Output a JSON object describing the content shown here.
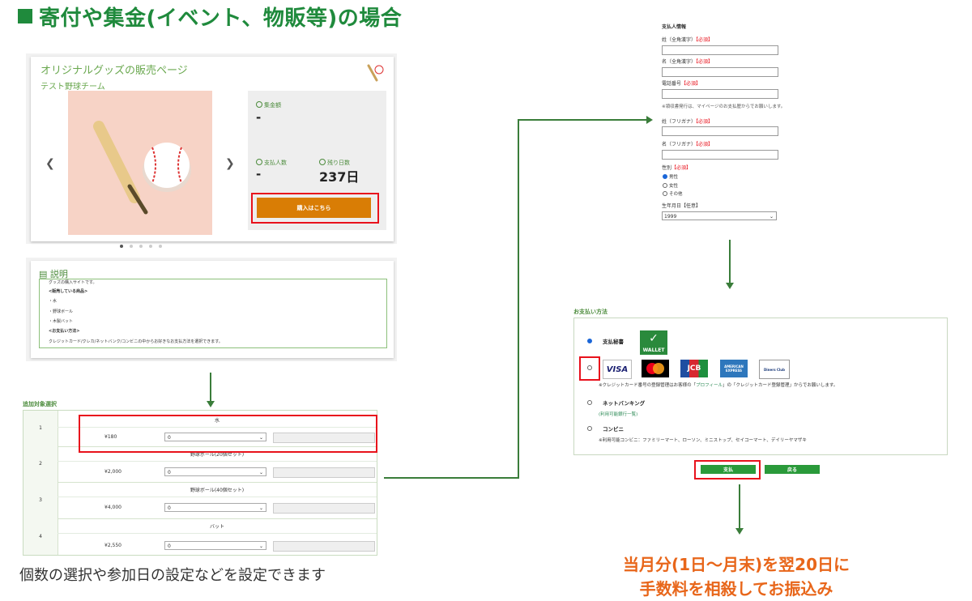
{
  "heading": "寄付や集金(イベント、物販等)の場合",
  "product": {
    "title": "オリジナルグッズの販売ページ",
    "team": "テスト野球チーム",
    "collected_label": "集金額",
    "collected_value": "-",
    "payers_label": "支払人数",
    "payers_value": "-",
    "days_left_label": "残り日数",
    "days_left_value": "237日",
    "buy_button": "購入はこちら"
  },
  "description": {
    "title": "説明",
    "lines": [
      "グッズの購入サイトです。",
      "<販売している商品>",
      "・水",
      "・野球ボール",
      "・木製バット",
      "<お支払い方法>",
      "クレジットカード/クレカ/ネットバンク/コンビニの中からお好きなお支払方法を選択できます。"
    ]
  },
  "selection": {
    "title": "追加対象選択",
    "rows": [
      {
        "num": "1",
        "name": "水",
        "price": "¥180",
        "qty": "0"
      },
      {
        "num": "2",
        "name": "野球ボール(20個セット)",
        "price": "¥2,000",
        "qty": "0"
      },
      {
        "num": "3",
        "name": "野球ボール(40個セット)",
        "price": "¥4,000",
        "qty": "0"
      },
      {
        "num": "4",
        "name": "バット",
        "price": "¥2,550",
        "qty": "0"
      }
    ]
  },
  "caption_left": "個数の選択や参加日の設定などを設定できます",
  "payer_form": {
    "title": "支払人情報",
    "required_tag": "【必須】",
    "fields": [
      {
        "label": "姓（全角漢字）"
      },
      {
        "label": "名（全角漢字）"
      },
      {
        "label": "電話番号"
      },
      {
        "label": "姓（フリガナ）"
      },
      {
        "label": "名（フリガナ）"
      }
    ],
    "phone_note": "※領収書発行は、マイページのお支払歴からでお願いします。",
    "gender_label": "性別",
    "gender_options": [
      "男性",
      "女性",
      "その他"
    ],
    "birth_label": "生年月日【任意】",
    "birth_year": "1999"
  },
  "payment": {
    "title": "お支払い方法",
    "wallet_option": "支払秘書",
    "wallet_logo": "WALLET",
    "card_logos": [
      "VISA",
      "mastercard",
      "JCB",
      "AMERICAN EXPRESS",
      "Diners Club"
    ],
    "card_note_prefix": "※クレジットカード番号の登録管理はお客様の「",
    "card_note_link": "プロフィール",
    "card_note_suffix": "」の「クレジットカード登録管理」からでお願いします。",
    "netbank_option": "ネットバンキング",
    "netbank_link": "(利用可能銀行一覧)",
    "conbini_option": "コンビニ",
    "conbini_note": "※利用可能コンビニ：ファミリーマート、ローソン、ミニストップ、セイコーマート、デイリーヤマザキ",
    "pay_button": "支払",
    "back_button": "戻る"
  },
  "caption_right": [
    "当月分(1日〜月末)を翌20日に",
    "手数料を相殺してお振込み"
  ],
  "colors": {
    "green": "#1f8a3c",
    "red": "#e8121c",
    "orange": "#e8661a",
    "buy": "#d97d05"
  }
}
